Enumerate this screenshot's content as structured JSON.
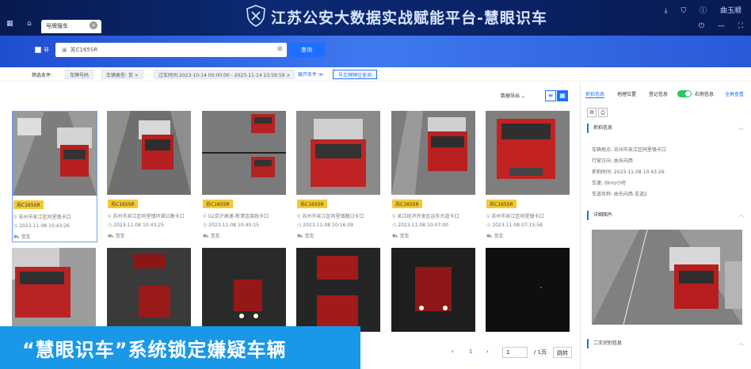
{
  "header": {
    "title": "江苏公安大数据实战赋能平台-慧眼识车",
    "tab_label": "号牌搜车",
    "icons": [
      "grid-icon",
      "home-icon",
      "download-icon",
      "shield-icon",
      "info-icon",
      "user-icon",
      "power-icon"
    ],
    "user": "曲玉顺"
  },
  "search": {
    "checkbox_label": "非",
    "value": "苏C165SR",
    "button": "查询"
  },
  "filters": {
    "label": "筛选条件:",
    "tags": [
      "车牌号码",
      "车辆类型: 货 ×",
      "过车时间:2023-10-14 00:00:00 - 2023-11-14 23:59:59 ×"
    ],
    "expand": "展开条件 ≫",
    "button": "号车牌牌往查询"
  },
  "toolbar": {
    "export": "数据导出 ⌄"
  },
  "cards": [
    {
      "plate": "苏C165SR",
      "location": "苏州市吴江区同里镇卡口",
      "time": "2023-11-08 10:43:26",
      "type": "货车"
    },
    {
      "plate": "苏C165SR",
      "location": "苏州市吴江区同里镇环湖公路卡口",
      "time": "2023-11-08 10:43:25",
      "type": "货车"
    },
    {
      "plate": "苏C165SR",
      "location": "G2京沪高速-新港连接线卡口",
      "time": "2023-11-08 10:40:15",
      "type": "货车"
    },
    {
      "plate": "苏C165SR",
      "location": "苏州市吴江区同里镇路口卡口",
      "time": "2023-11-08 10:16:09",
      "type": "货车"
    },
    {
      "plate": "苏C165SR",
      "location": "吴江经济开发区运东大道卡口",
      "time": "2023-11-08 10:07:00",
      "type": "货车"
    },
    {
      "plate": "苏C165SR",
      "location": "苏州市吴江区同里镇卡口",
      "time": "2023-11-08 07:15:58",
      "type": "货车"
    }
  ],
  "right": {
    "tabs": [
      "抓拍信息",
      "地理位置",
      "登记信息",
      "右侧信息",
      "全屏查看"
    ],
    "section1": "抓拍信息",
    "lines": [
      "车辆地点: 苏州市吴江区同里镇卡口",
      "行驶方向: 由东向西",
      "抓拍时间: 2023-11-08 10:43:26",
      "车速: 0km/小时",
      "车道名称: 由东向西-车道2"
    ],
    "section2": "详细图片",
    "section3": "二次识别信息"
  },
  "pager": {
    "page": "1",
    "input": "1",
    "total": "/ 1页",
    "go": "跳转"
  },
  "caption": "“慧眼识车”系统锁定嫌疑车辆"
}
